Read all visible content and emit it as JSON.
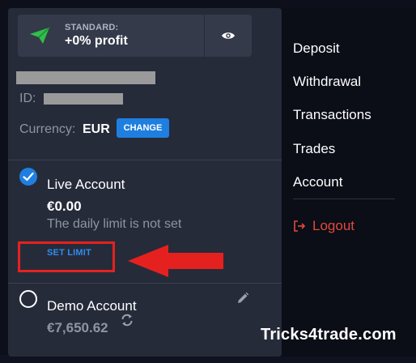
{
  "status": {
    "label": "STANDARD:",
    "value": "+0% profit",
    "plane_icon": "paper-plane-icon",
    "eye_icon": "eye-icon"
  },
  "profile": {
    "id_label": "ID:",
    "currency_label": "Currency:",
    "currency_value": "EUR",
    "change_label": "CHANGE"
  },
  "accounts": {
    "live": {
      "name": "Live Account",
      "balance": "€0.00",
      "daily_limit_text": "The daily limit is not set",
      "set_limit_label": "SET LIMIT",
      "selected": true
    },
    "demo": {
      "name": "Demo Account",
      "balance": "€7,650.62",
      "selected": false
    }
  },
  "menu": {
    "items": [
      "Deposit",
      "Withdrawal",
      "Transactions",
      "Trades",
      "Account"
    ],
    "logout_label": "Logout"
  },
  "watermark": "Tricks4trade.com",
  "colors": {
    "accent_blue": "#1f7fe0",
    "link_blue": "#2f8cf0",
    "logout_red": "#e24a3b",
    "annotation_red": "#e5211f",
    "plane_green": "#2fbf4a"
  }
}
